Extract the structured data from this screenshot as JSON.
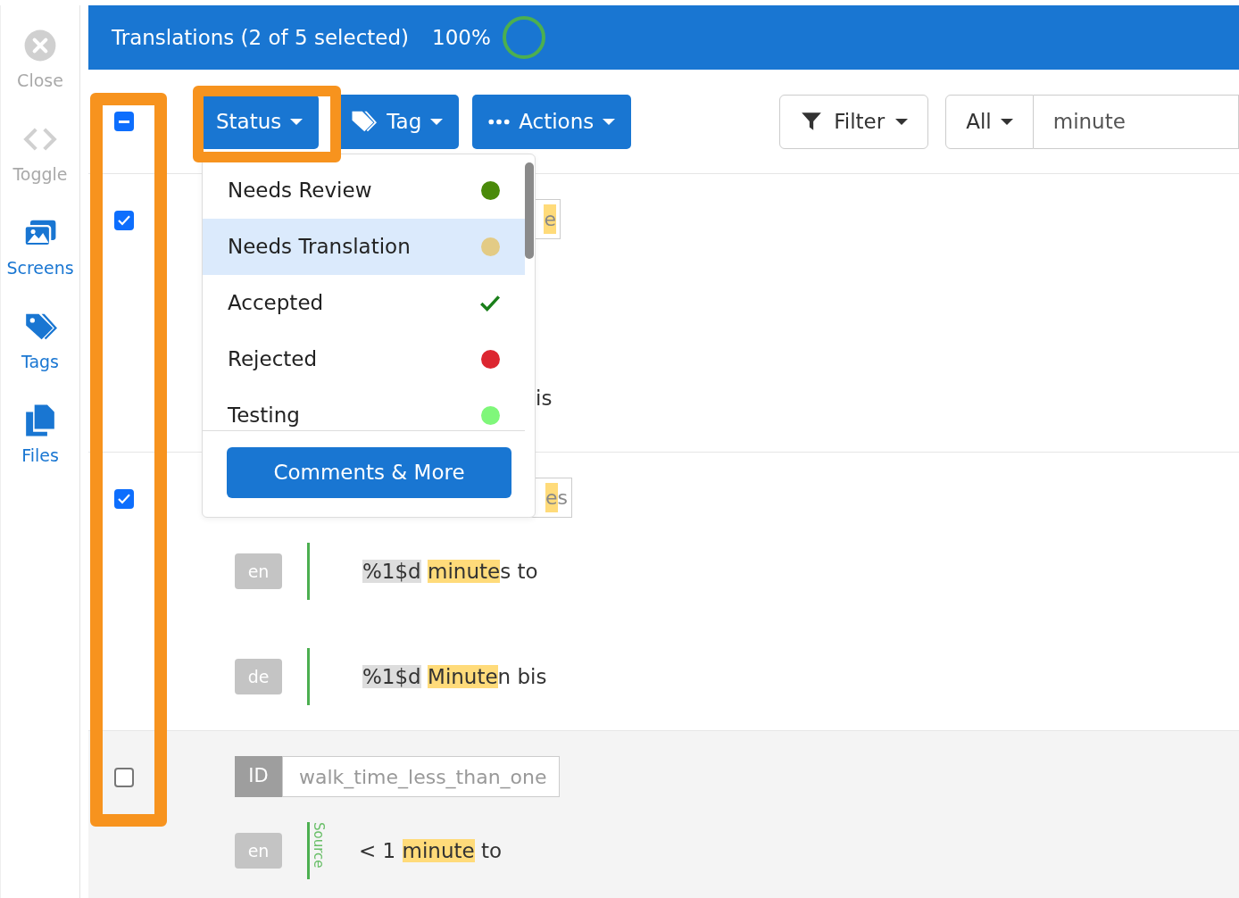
{
  "sidebar": {
    "items": [
      {
        "label": "Close",
        "disabled": true
      },
      {
        "label": "Toggle",
        "disabled": true
      },
      {
        "label": "Screens",
        "disabled": false
      },
      {
        "label": "Tags",
        "disabled": false
      },
      {
        "label": "Files",
        "disabled": false
      }
    ]
  },
  "header": {
    "title": "Translations (2 of 5 selected)",
    "percent": "100%"
  },
  "toolbar": {
    "select_all": {
      "checked": true,
      "indeterminate": true
    },
    "buttons": [
      {
        "label": "Status"
      },
      {
        "label": "Tag"
      },
      {
        "label": "Actions"
      }
    ],
    "filter": {
      "label": "Filter"
    },
    "scope": {
      "label": "All"
    },
    "search": {
      "value": "minute"
    }
  },
  "rows": [
    {
      "checked": true,
      "id_field": {
        "value": [
          {
            "text": "e",
            "kind": "match"
          }
        ]
      },
      "lines": [
        {
          "text": [
            {
              "text": "is"
            }
          ]
        }
      ]
    },
    {
      "checked": true,
      "id_field": {
        "value": [
          {
            "text": "e",
            "kind": "match"
          },
          {
            "text": "s"
          }
        ]
      },
      "lines": [
        {
          "lang": "en",
          "text": [
            {
              "text": "%1$d",
              "kind": "placeholder"
            },
            {
              "text": "minute",
              "kind": "match"
            },
            {
              "text": "s to"
            }
          ]
        },
        {
          "lang": "de",
          "text": [
            {
              "text": "%1$d",
              "kind": "placeholder"
            },
            {
              "text": "Minute",
              "kind": "match"
            },
            {
              "text": "n bis"
            }
          ]
        }
      ]
    },
    {
      "checked": false,
      "id_field": {
        "label": "ID",
        "value": [
          {
            "text": "walk_time_less_than_one"
          }
        ]
      },
      "lines": [
        {
          "lang": "en",
          "source": "Source",
          "text": [
            {
              "text": "< 1 "
            },
            {
              "text": "minute",
              "kind": "match"
            },
            {
              "text": " to"
            }
          ]
        }
      ]
    }
  ],
  "status_menu": {
    "items": [
      {
        "label": "Needs Review",
        "kind": "dot",
        "color": "#4a8a0a",
        "selected": false
      },
      {
        "label": "Needs Translation",
        "kind": "dot",
        "color": "#e3cb85",
        "selected": true
      },
      {
        "label": "Accepted",
        "kind": "check",
        "selected": false
      },
      {
        "label": "Rejected",
        "kind": "dot",
        "color": "#dc2630",
        "selected": false
      },
      {
        "label": "Testing",
        "kind": "dot",
        "color": "#7ff77a",
        "selected": false
      }
    ],
    "button": "Comments & More"
  },
  "annotations": [
    {
      "kind": "frame"
    },
    {
      "kind": "frame"
    }
  ]
}
